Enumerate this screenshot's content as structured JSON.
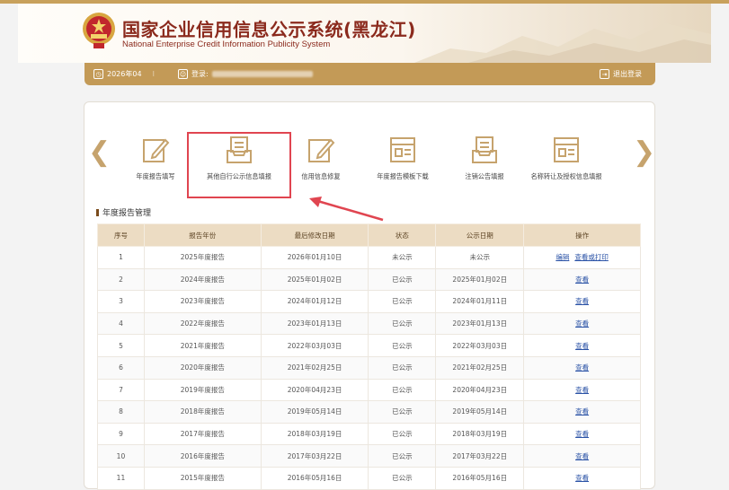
{
  "header": {
    "title": "国家企业信用信息公示系统(黑龙江)",
    "subtitle": "National Enterprise Credit Information Publicity System"
  },
  "userbar": {
    "date": "2026年04",
    "login_label": "登录:",
    "logout": "退出登录"
  },
  "nav": {
    "items": [
      {
        "label": "年度报告填写",
        "icon": "edit-icon"
      },
      {
        "label": "其他自行公示信息填报",
        "icon": "document-tray-icon"
      },
      {
        "label": "信用信息修复",
        "icon": "edit-icon"
      },
      {
        "label": "年度报告模板下载",
        "icon": "template-icon"
      },
      {
        "label": "注销公告填报",
        "icon": "document-tray-icon"
      },
      {
        "label": "名称转让及授权信息填报",
        "icon": "template-icon"
      }
    ]
  },
  "section": {
    "title": "年度报告管理"
  },
  "table": {
    "columns": [
      "序号",
      "报告年份",
      "最后修改日期",
      "状态",
      "公示日期",
      "操作"
    ],
    "rows": [
      {
        "no": "1",
        "year": "2025年度报告",
        "modified": "2026年01月10日",
        "status": "未公示",
        "published": "未公示",
        "actions": [
          "编辑",
          "查看或打印"
        ]
      },
      {
        "no": "2",
        "year": "2024年度报告",
        "modified": "2025年01月02日",
        "status": "已公示",
        "published": "2025年01月02日",
        "actions": [
          "查看"
        ]
      },
      {
        "no": "3",
        "year": "2023年度报告",
        "modified": "2024年01月12日",
        "status": "已公示",
        "published": "2024年01月11日",
        "actions": [
          "查看"
        ]
      },
      {
        "no": "4",
        "year": "2022年度报告",
        "modified": "2023年01月13日",
        "status": "已公示",
        "published": "2023年01月13日",
        "actions": [
          "查看"
        ]
      },
      {
        "no": "5",
        "year": "2021年度报告",
        "modified": "2022年03月03日",
        "status": "已公示",
        "published": "2022年03月03日",
        "actions": [
          "查看"
        ]
      },
      {
        "no": "6",
        "year": "2020年度报告",
        "modified": "2021年02月25日",
        "status": "已公示",
        "published": "2021年02月25日",
        "actions": [
          "查看"
        ]
      },
      {
        "no": "7",
        "year": "2019年度报告",
        "modified": "2020年04月23日",
        "status": "已公示",
        "published": "2020年04月23日",
        "actions": [
          "查看"
        ]
      },
      {
        "no": "8",
        "year": "2018年度报告",
        "modified": "2019年05月14日",
        "status": "已公示",
        "published": "2019年05月14日",
        "actions": [
          "查看"
        ]
      },
      {
        "no": "9",
        "year": "2017年度报告",
        "modified": "2018年03月19日",
        "status": "已公示",
        "published": "2018年03月19日",
        "actions": [
          "查看"
        ]
      },
      {
        "no": "10",
        "year": "2016年度报告",
        "modified": "2017年03月22日",
        "status": "已公示",
        "published": "2017年03月22日",
        "actions": [
          "查看"
        ]
      },
      {
        "no": "11",
        "year": "2015年度报告",
        "modified": "2016年05月16日",
        "status": "已公示",
        "published": "2016年05月16日",
        "actions": [
          "查看"
        ]
      }
    ]
  },
  "colors": {
    "gold": "#c39a57",
    "title_red": "#8b2a1d",
    "highlight": "#e04550",
    "link": "#2a52a6"
  }
}
